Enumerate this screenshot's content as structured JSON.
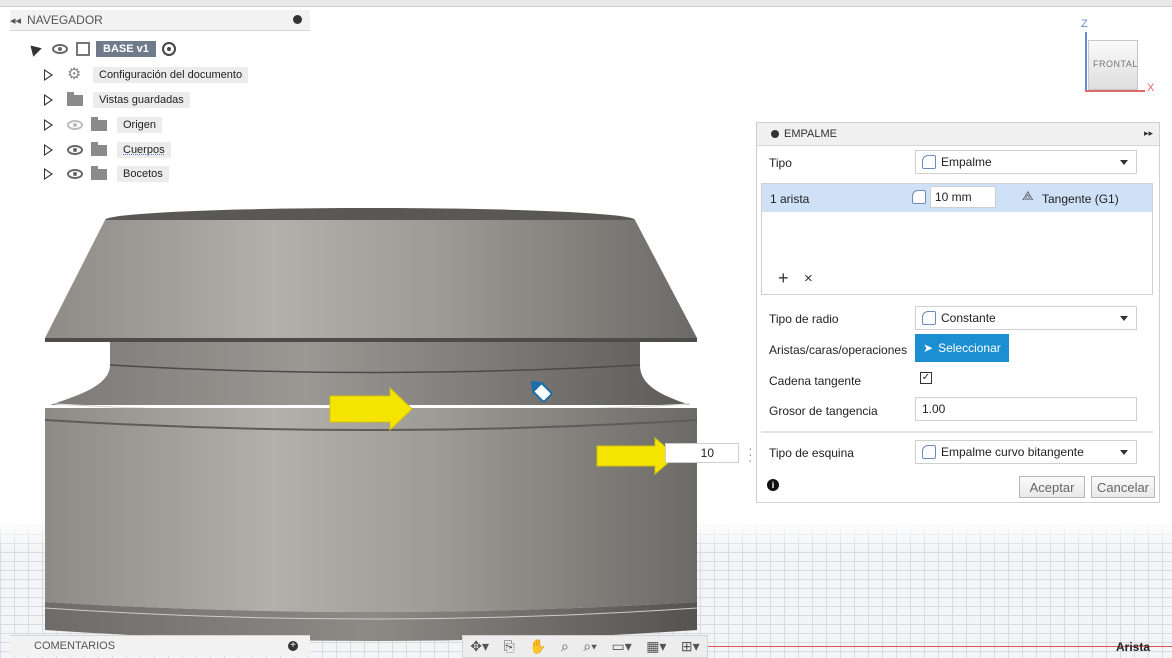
{
  "navigator": {
    "title": "NAVEGADOR",
    "items": [
      {
        "label": "BASE v1"
      },
      {
        "label": "Configuración del documento"
      },
      {
        "label": "Vistas guardadas"
      },
      {
        "label": "Origen"
      },
      {
        "label": "Cuerpos"
      },
      {
        "label": "Bocetos"
      }
    ]
  },
  "viewcube": {
    "face": "FRONTAL",
    "axis_z": "Z",
    "axis_x": "X"
  },
  "viewport": {
    "dimension_input": "10"
  },
  "panel": {
    "title": "EMPALME",
    "tipo_label": "Tipo",
    "tipo_value": "Empalme",
    "selection": {
      "label": "1 arista",
      "radius": "10 mm",
      "continuity": "Tangente (G1)"
    },
    "add_symbol": "+",
    "remove_symbol": "×",
    "tipo_radio_label": "Tipo de radio",
    "tipo_radio_value": "Constante",
    "aristas_label": "Aristas/caras/operaciones",
    "select_button": "Seleccionar",
    "cadena_label": "Cadena tangente",
    "cadena_checked": true,
    "grosor_label": "Grosor de tangencia",
    "grosor_value": "1.00",
    "esquina_label": "Tipo de esquina",
    "esquina_value": "Empalme curvo bitangente",
    "accept": "Aceptar",
    "cancel": "Cancelar"
  },
  "comments": {
    "title": "COMENTARIOS"
  },
  "status": {
    "text": "Arista"
  },
  "colors": {
    "accent": "#1b8fd1",
    "selection": "#cfe1f7",
    "arrow": "#f5e400"
  }
}
